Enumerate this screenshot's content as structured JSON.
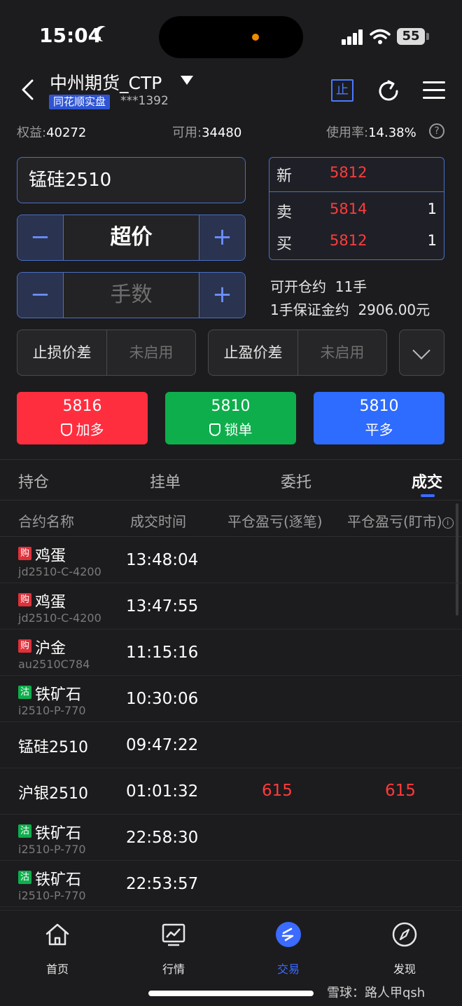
{
  "status_bar": {
    "time": "15:04",
    "battery": "55"
  },
  "header": {
    "account_name": "中州期货_CTP",
    "badge": "同花顺实盘",
    "account_no": "***1392",
    "stop_label": "止"
  },
  "summary": {
    "equity_label": "权益:",
    "equity_value": "40272",
    "available_label": "可用:",
    "available_value": "34480",
    "usage_label": "使用率:",
    "usage_value": "14.38%"
  },
  "order_form": {
    "contract": "锰硅2510",
    "price_type": "超价",
    "quantity_placeholder": "手数",
    "minus": "−",
    "plus": "+",
    "stop_loss_label": "止损价差",
    "stop_loss_value": "未启用",
    "take_profit_label": "止盈价差",
    "take_profit_value": "未启用"
  },
  "quote": {
    "last_label": "新",
    "last_price": "5812",
    "ask_label": "卖",
    "ask_price": "5814",
    "ask_vol": "1",
    "bid_label": "买",
    "bid_price": "5812",
    "bid_vol": "1"
  },
  "info": {
    "open_label": "可开仓约",
    "open_value": "11手",
    "margin_label": "1手保证金约",
    "margin_value": "2906.00元"
  },
  "actions": {
    "buy": {
      "price": "5816",
      "label": "加多"
    },
    "lock": {
      "price": "5810",
      "label": "锁单"
    },
    "close": {
      "price": "5810",
      "label": "平多"
    }
  },
  "tabs": [
    "持仓",
    "挂单",
    "委托",
    "成交"
  ],
  "table": {
    "headers": [
      "合约名称",
      "成交时间",
      "平仓盈亏(逐笔)",
      "平仓盈亏(盯市)"
    ],
    "rows": [
      {
        "tag": "购",
        "name": "鸡蛋",
        "code": "jd2510-C-4200",
        "time": "13:48:04",
        "pnl1": "",
        "pnl2": ""
      },
      {
        "tag": "购",
        "name": "鸡蛋",
        "code": "jd2510-C-4200",
        "time": "13:47:55",
        "pnl1": "",
        "pnl2": ""
      },
      {
        "tag": "购",
        "name": "沪金",
        "code": "au2510C784",
        "time": "11:15:16",
        "pnl1": "",
        "pnl2": ""
      },
      {
        "tag": "沽",
        "name": "铁矿石",
        "code": "i2510-P-770",
        "time": "10:30:06",
        "pnl1": "",
        "pnl2": ""
      },
      {
        "tag": "",
        "name": "锰硅2510",
        "code": "",
        "time": "09:47:22",
        "pnl1": "",
        "pnl2": ""
      },
      {
        "tag": "",
        "name": "沪银2510",
        "code": "",
        "time": "01:01:32",
        "pnl1": "615",
        "pnl2": "615"
      },
      {
        "tag": "沽",
        "name": "铁矿石",
        "code": "i2510-P-770",
        "time": "22:58:30",
        "pnl1": "",
        "pnl2": ""
      },
      {
        "tag": "沽",
        "name": "铁矿石",
        "code": "i2510-P-770",
        "time": "22:53:57",
        "pnl1": "",
        "pnl2": ""
      }
    ]
  },
  "bottom_nav": [
    {
      "label": "首页",
      "icon": "home-icon"
    },
    {
      "label": "行情",
      "icon": "chart-icon"
    },
    {
      "label": "交易",
      "icon": "trade-icon"
    },
    {
      "label": "发现",
      "icon": "compass-icon"
    }
  ],
  "watermark": "雪球：路人甲qsh",
  "colors": {
    "accent": "#3b6bff",
    "up": "#ff3b3b",
    "buy_button": "#ff2e3f",
    "lock_button": "#0eae4c",
    "close_button": "#2e6bff"
  }
}
